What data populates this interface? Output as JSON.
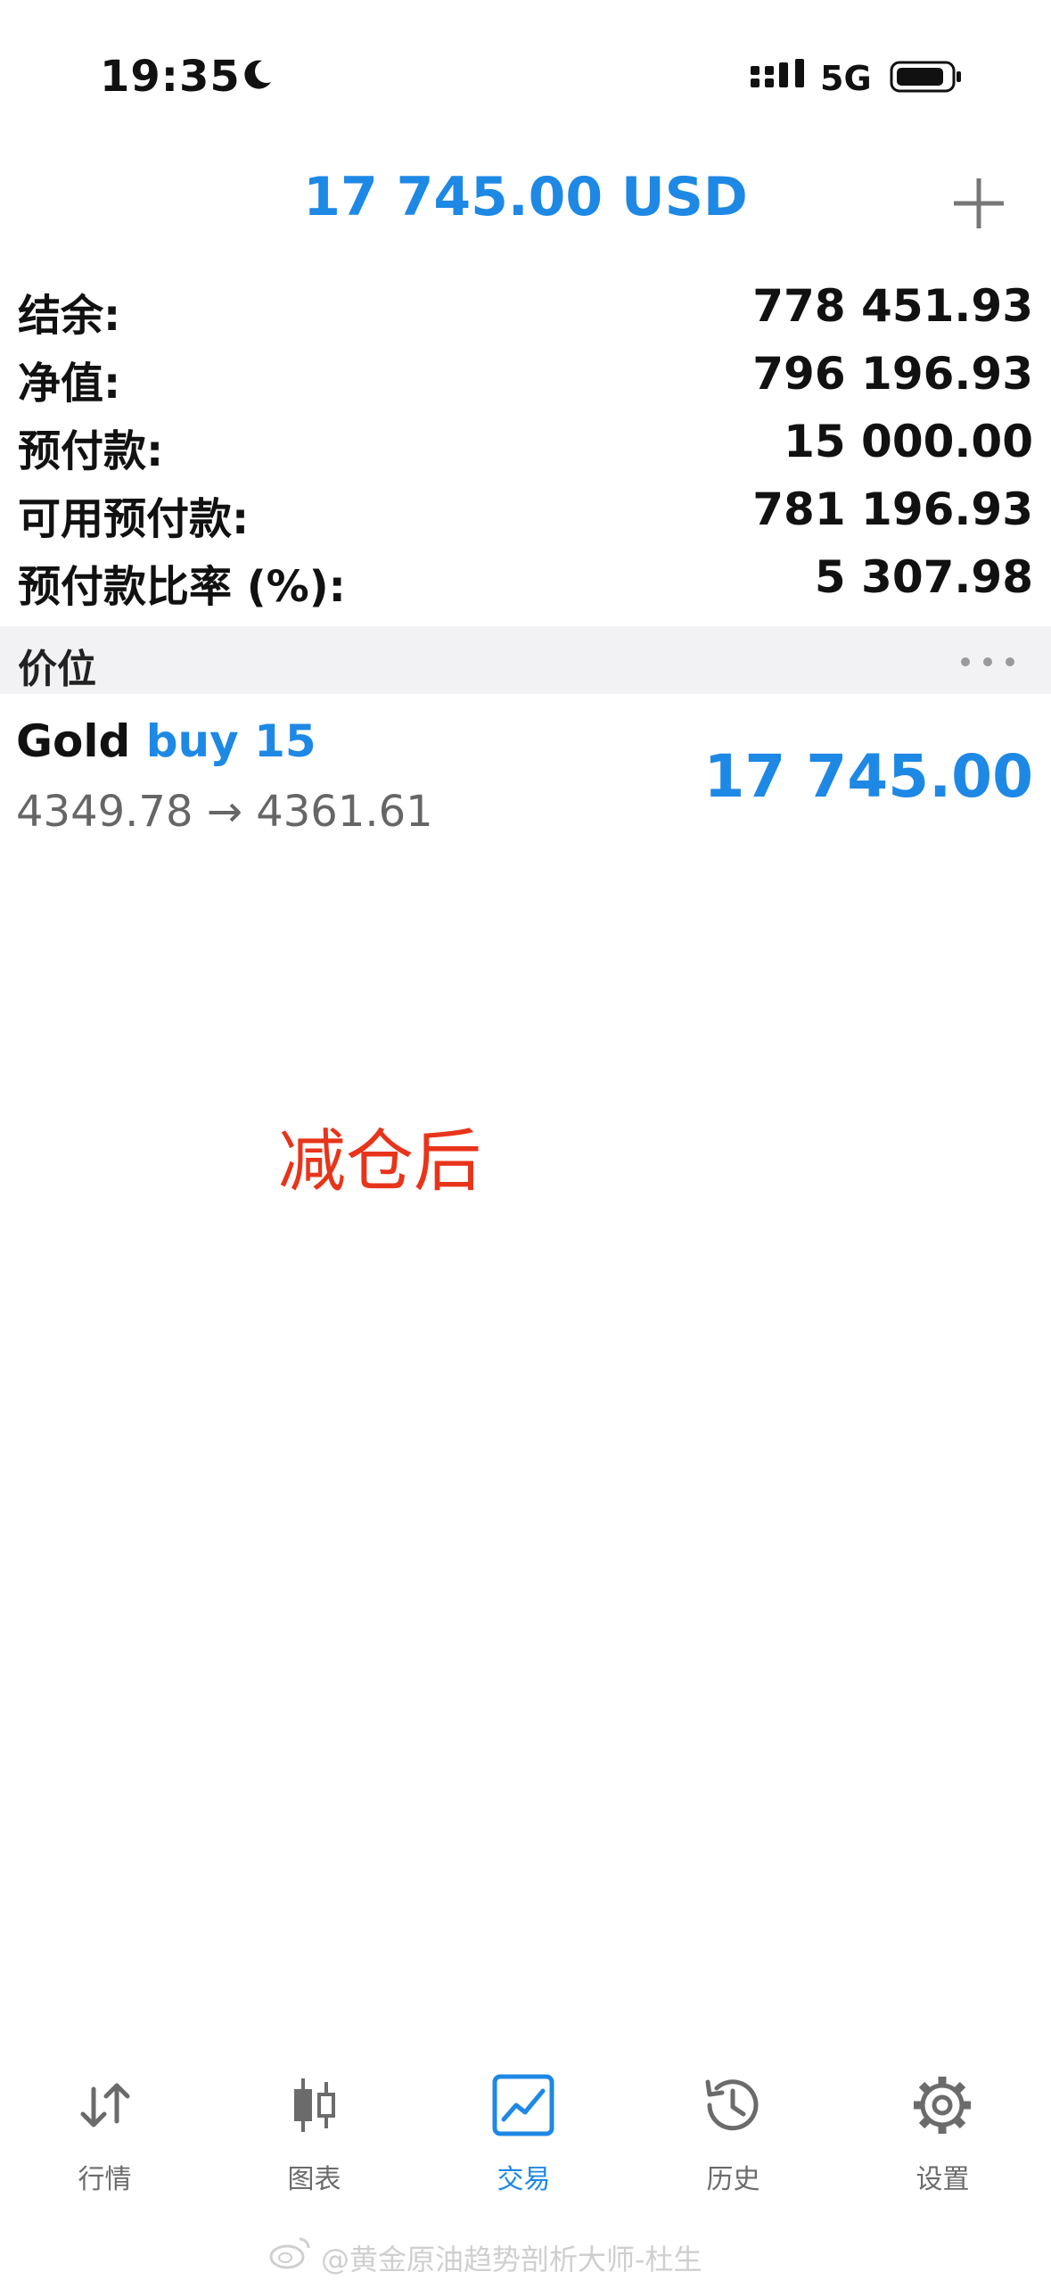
{
  "status_bar": {
    "time": "19:35",
    "network": "5G"
  },
  "header": {
    "title": "17 745.00 USD"
  },
  "summary": [
    {
      "label": "结余:",
      "value": "778 451.93"
    },
    {
      "label": "净值:",
      "value": "796 196.93"
    },
    {
      "label": "预付款:",
      "value": "15 000.00"
    },
    {
      "label": "可用预付款:",
      "value": "781 196.93"
    },
    {
      "label": "预付款比率 (%):",
      "value": "5 307.98"
    }
  ],
  "section": {
    "title": "价位"
  },
  "position": {
    "symbol": "Gold",
    "direction": "buy 15",
    "prices": "4349.78 → 4361.61",
    "profit": "17 745.00"
  },
  "annotation": "减仓后",
  "tabs": [
    {
      "label": "行情",
      "icon": "arrows-updown-icon",
      "active": false
    },
    {
      "label": "图表",
      "icon": "candlestick-icon",
      "active": false
    },
    {
      "label": "交易",
      "icon": "trade-chart-icon",
      "active": true
    },
    {
      "label": "历史",
      "icon": "history-icon",
      "active": false
    },
    {
      "label": "设置",
      "icon": "gear-icon",
      "active": false
    }
  ],
  "watermark": "@黄金原油趋势剖析大师-杜生",
  "colors": {
    "accent": "#1e88e5",
    "annotation": "#e8341a"
  }
}
